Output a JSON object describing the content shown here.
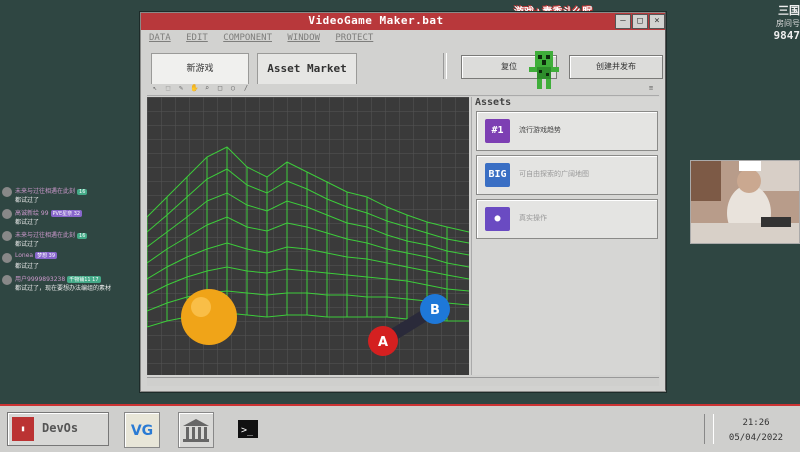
{
  "window": {
    "title": "VideoGame Maker.bat",
    "controls": {
      "minimize": "–",
      "maximize": "□",
      "close": "×"
    }
  },
  "menubar": [
    "DATA",
    "EDIT",
    "COMPONENT",
    "WINDOW",
    "PROTECT"
  ],
  "tabs": [
    {
      "label": "新游戏"
    },
    {
      "label": "Asset Market"
    }
  ],
  "buttons": {
    "reset": "复位",
    "create_publish": "创建并发布"
  },
  "assets": {
    "title": "Assets",
    "items": [
      {
        "label": "流行游戏趋势",
        "icon_text": "#1",
        "icon_color": "#7d3fb3"
      },
      {
        "label": "可自由探索的广阔地图",
        "icon_text": "BIG",
        "icon_color": "#3a6fc4"
      },
      {
        "label": "真实操作",
        "icon_text": "●",
        "icon_color": "#6a4bc2"
      }
    ]
  },
  "overlay_text": "游戏+素香斗么眠",
  "corner_logo": {
    "line1": "三国",
    "line2": "房间号",
    "number": "9847"
  },
  "chat": [
    {
      "name": "未来与过往相遇在此刻",
      "badge": "16",
      "text": "都试过了"
    },
    {
      "name": "高诚新绘 99",
      "badge": "PVE星奈 32",
      "text": "都试过了"
    },
    {
      "name": "未来与过往相遇在此刻",
      "badge": "16",
      "text": "都试过了"
    },
    {
      "name": "Lonea",
      "badge": "梦想 39",
      "text": "都试过了"
    },
    {
      "name": "用户9999893238",
      "badge": "千物铺11 17",
      "text": "都试过了，现在要想办法编组的素材"
    }
  ],
  "taskbar": {
    "start_label": "DevOs",
    "time": "21:26",
    "date": "05/04/2022"
  }
}
